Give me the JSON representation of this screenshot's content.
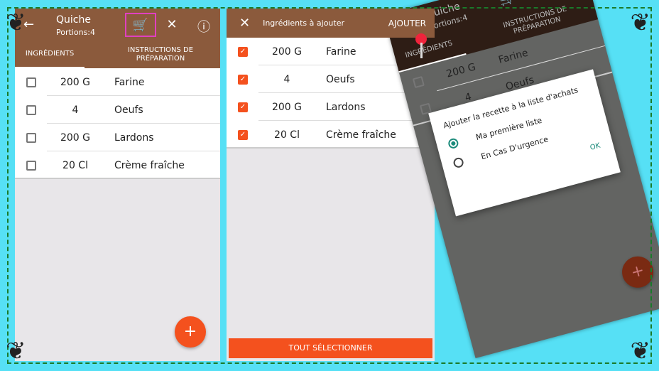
{
  "recipe": {
    "title": "Quiche",
    "portions": "Portions:4"
  },
  "tabs": {
    "ingredients": "INGRÉDIENTS",
    "instructions": "INSTRUCTIONS DE PRÉPARATION"
  },
  "icons": {
    "back": "arrow-left-icon",
    "cart": "cart-plus-icon",
    "utensils": "utensils-icon",
    "info": "info-icon"
  },
  "ingredients": [
    {
      "qty": "200 G",
      "name": "Farine"
    },
    {
      "qty": "4",
      "name": "Oeufs"
    },
    {
      "qty": "200 G",
      "name": "Lardons"
    },
    {
      "qty": "20 Cl",
      "name": "Crème fraîche"
    }
  ],
  "add_screen": {
    "title": "Ingrédients à ajouter",
    "action": "AJOUTER",
    "select_all": "TOUT SÉLECTIONNER"
  },
  "dialog": {
    "title": "Ajouter la recette à la liste d'achats",
    "options": [
      "Ma première liste",
      "En Cas D'urgence"
    ],
    "selected": "Ma première liste",
    "ok": "OK"
  },
  "fab": "+",
  "colors": {
    "brand": "#8b5a3c",
    "accent": "#f4511e",
    "background": "#56e0f5",
    "dialog_accent": "#1a8a7a"
  }
}
